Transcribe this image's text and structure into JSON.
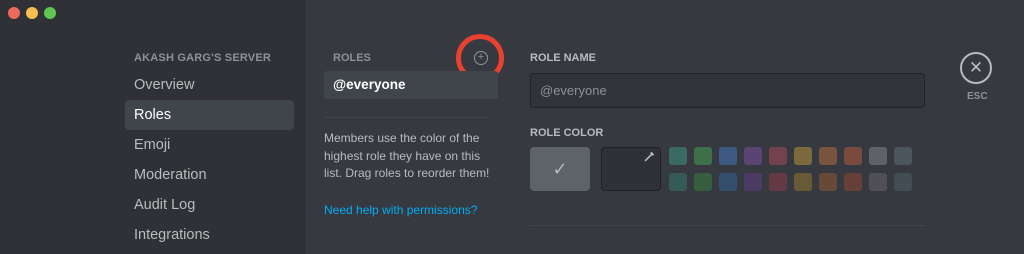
{
  "window": {
    "controls": [
      "close",
      "minimize",
      "maximize"
    ]
  },
  "sidebar": {
    "server_name": "AKASH GARG'S SERVER",
    "items": [
      {
        "label": "Overview"
      },
      {
        "label": "Roles",
        "active": true
      },
      {
        "label": "Emoji"
      },
      {
        "label": "Moderation"
      },
      {
        "label": "Audit Log"
      },
      {
        "label": "Integrations"
      }
    ]
  },
  "roles_panel": {
    "header": "ROLES",
    "add_icon": "plus-circle-icon",
    "selected_role": "@everyone",
    "help_text": "Members use the color of the highest role they have on this list. Drag roles to reorder them!",
    "help_link": "Need help with permissions?"
  },
  "role_editor": {
    "name_label": "ROLE NAME",
    "name_value": "@everyone",
    "color_label": "ROLE COLOR",
    "default_color": "#5e6269",
    "default_icon": "checkmark-icon",
    "custom_icon": "eyedropper-icon",
    "palette_row1": [
      "#3a6b60",
      "#3d7048",
      "#3d5a82",
      "#594574",
      "#74414f",
      "#7a6a3d",
      "#7a553d",
      "#7a4a3e",
      "#5e6168",
      "#4c555c"
    ],
    "palette_row2": [
      "#355b54",
      "#355e3e",
      "#344e6e",
      "#4b3b62",
      "#633944",
      "#675a36",
      "#664a37",
      "#663f37",
      "#504f55",
      "#454d54"
    ]
  },
  "close": {
    "icon": "close-icon",
    "label": "ESC"
  },
  "accents": {
    "highlight_ring": "#e8412f",
    "link": "#00aff4"
  }
}
